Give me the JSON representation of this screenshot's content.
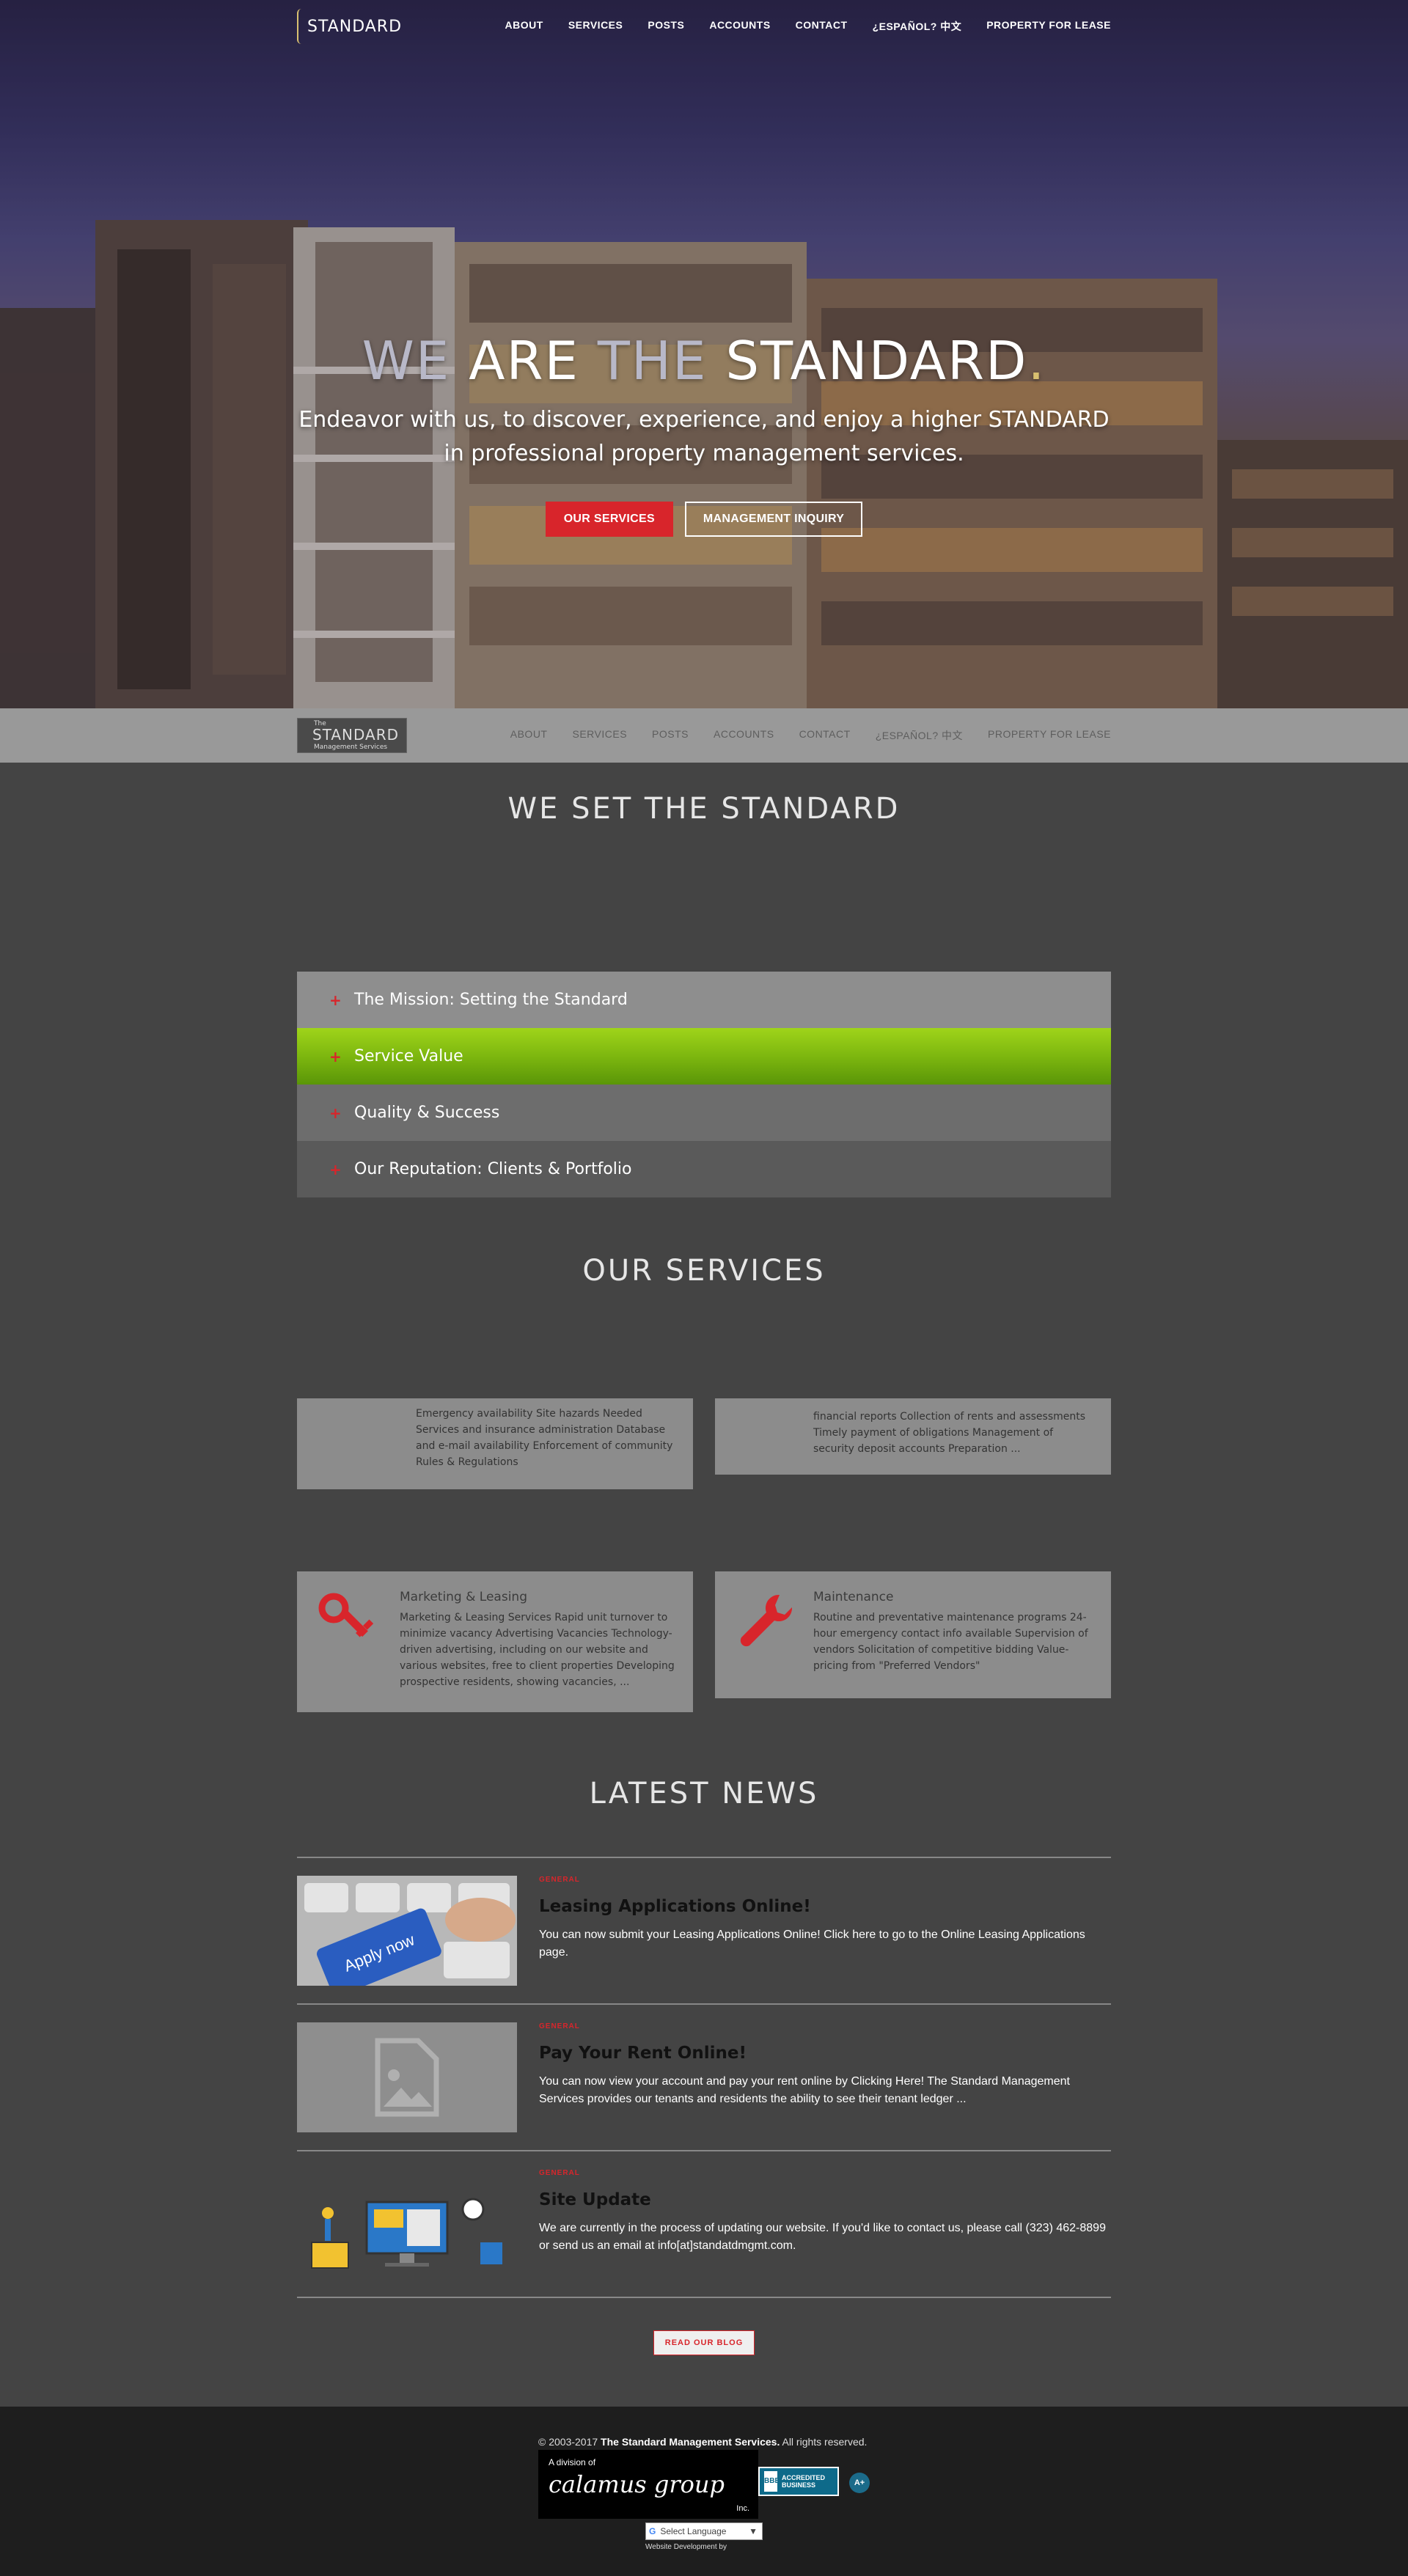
{
  "header": {
    "logo_text": "STANDARD",
    "nav": [
      "ABOUT",
      "SERVICES",
      "POSTS",
      "ACCOUNTS",
      "CONTACT",
      "¿ESPAÑOL? 中文",
      "PROPERTY FOR LEASE"
    ]
  },
  "hero": {
    "title_we": "WE",
    "title_are": "ARE",
    "title_the": "THE",
    "title_standard": "STANDARD",
    "title_dot": ".",
    "subtitle": "Endeavor with us, to discover, experience, and enjoy a higher STANDARD in professional property management services.",
    "btn_services": "OUR SERVICES",
    "btn_inquiry": "MANAGEMENT INQUIRY"
  },
  "sticky": {
    "logo_the": "The",
    "logo_big": "STANDARD",
    "logo_small": "Management Services",
    "nav": [
      "ABOUT",
      "SERVICES",
      "POSTS",
      "ACCOUNTS",
      "CONTACT",
      "¿ESPAÑOL? 中文",
      "PROPERTY FOR LEASE"
    ]
  },
  "mission": {
    "title": "WE SET THE STANDARD",
    "accordion": [
      {
        "label": "The Mission: Setting the Standard"
      },
      {
        "label": "Service Value"
      },
      {
        "label": "Quality & Success"
      },
      {
        "label": "Our Reputation: Clients & Portfolio"
      }
    ],
    "plus": "+"
  },
  "services": {
    "title": "OUR SERVICES",
    "cards": [
      {
        "title": "",
        "text": "Emergency availability Site hazards Needed Services and insurance administration Database and e-mail availability Enforcement of community Rules & Regulations"
      },
      {
        "title": "",
        "text": "financial reports Collection of rents and assessments Timely payment of obligations Management of security deposit accounts Preparation ..."
      },
      {
        "title": "Marketing & Leasing",
        "text": "Marketing & Leasing Services Rapid unit turnover to minimize vacancy Advertising Vacancies Technology-driven advertising, including on our website and various websites, free to client properties Developing prospective residents, showing vacancies, ..."
      },
      {
        "title": "Maintenance",
        "text": "Routine and preventative maintenance programs 24-hour emergency contact info available Supervision of vendors Solicitation of competitive bidding Value-pricing from \"Preferred Vendors\""
      }
    ],
    "colors": {
      "icon": "#d8252b"
    }
  },
  "news": {
    "title": "LATEST NEWS",
    "items": [
      {
        "category": "GENERAL",
        "title": "Leasing Applications Online!",
        "text": "You can now submit your Leasing Applications Online! Click here to go to the Online Leasing Applications page.",
        "thumb_key": "Apply now"
      },
      {
        "category": "GENERAL",
        "title": "Pay Your Rent Online!",
        "text": "You can now view your account and pay your rent online by Clicking Here! The Standard Management Services provides our tenants and residents the ability to see their tenant ledger ..."
      },
      {
        "category": "GENERAL",
        "title": "Site Update",
        "text": "We are currently in the process of updating our website. If you'd like to contact us, please call (323) 462-8899  or send us an email at info[at]standatdmgmt.com."
      }
    ],
    "read_blog": "READ OUR BLOG"
  },
  "footer": {
    "copyright_prefix": "© 2003-2017",
    "company": "The Standard Management Services.",
    "rights": "All rights reserved.",
    "division_label": "A division of",
    "division_brand": "calamus group",
    "division_inc": "Inc.",
    "bbb_text": "ACCREDITED BUSINESS",
    "bbb_seal": "BBB",
    "bbb_rating": "A+",
    "translate_g": "G",
    "translate_label": "Select Language",
    "translate_arrow": "▼",
    "dev_by": "Website Development by"
  },
  "colors": {
    "accent": "#d8252b",
    "green": "#7db70f",
    "page_bg": "#444444",
    "footer_bg": "#1e1e1e"
  }
}
